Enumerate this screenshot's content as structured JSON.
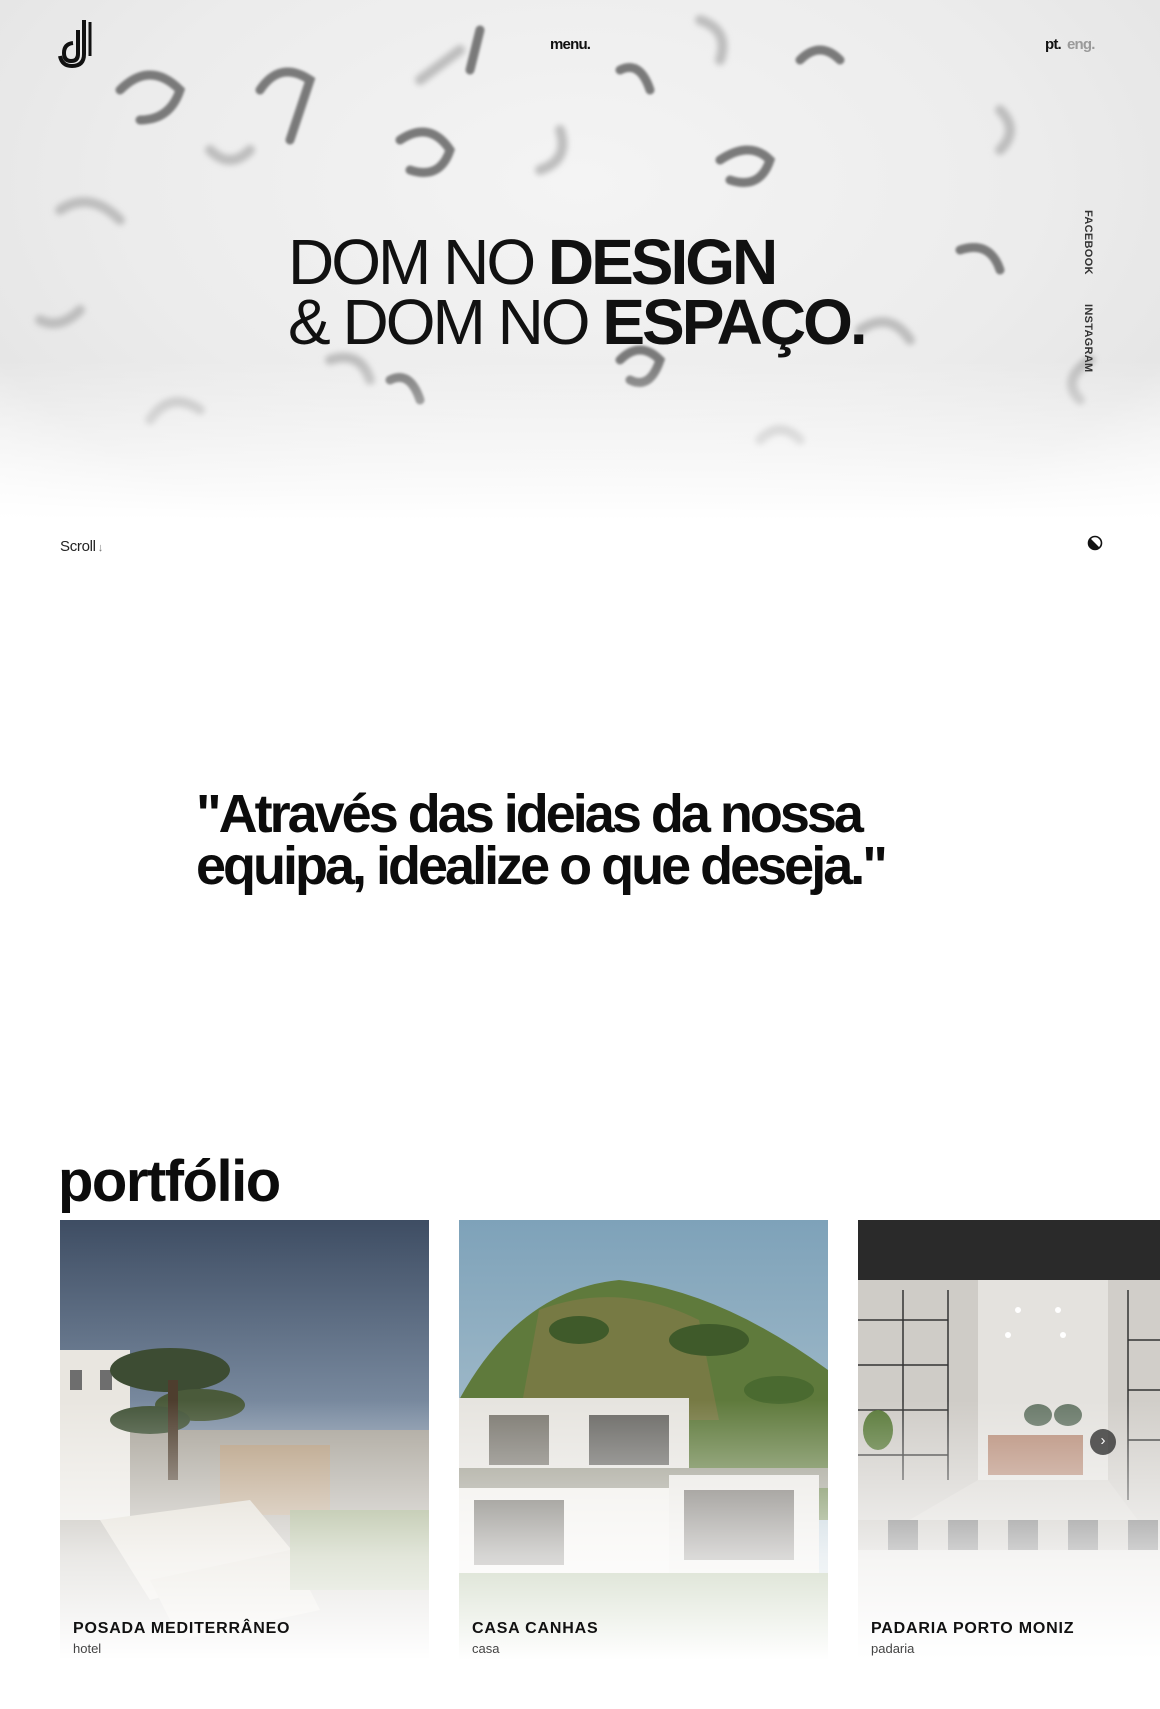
{
  "header": {
    "menu_label": "menu.",
    "lang_pt": "pt.",
    "lang_eng": "eng."
  },
  "social": {
    "facebook": "FACEBOOK",
    "instagram": "INSTAGRAM"
  },
  "hero": {
    "line1_light": "DOM NO ",
    "line1_bold": "DESIGN",
    "line2_light": "& DOM NO ",
    "line2_bold": "ESPAÇO."
  },
  "scroll_label": "Scroll",
  "quote": "\"Através das ideias da nossa equipa, idealize o que deseja.\"",
  "portfolio": {
    "title": "portfólio",
    "items": [
      {
        "title": "POSADA MEDITERRÂNEO",
        "type": "hotel"
      },
      {
        "title": "CASA CANHAS",
        "type": "casa"
      },
      {
        "title": "PADARIA PORTO MONIZ",
        "type": "padaria"
      }
    ]
  },
  "icons": {
    "logo": "dj-logo-icon",
    "contrast": "contrast-toggle-icon",
    "scroll_arrow": "arrow-down-icon",
    "next": "chevron-right-icon"
  }
}
